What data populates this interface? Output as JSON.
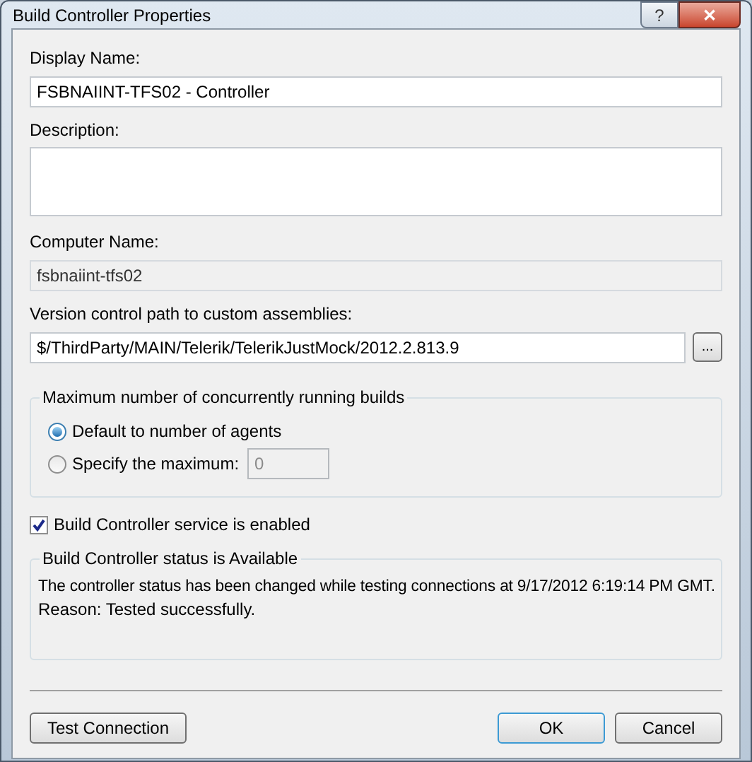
{
  "window": {
    "title": "Build Controller Properties",
    "title_buttons": [
      "?",
      "✕"
    ]
  },
  "display_name": {
    "label": "Display Name:",
    "value": "FSBNAIINT-TFS02 - Controller"
  },
  "description": {
    "label": "Description:"
  },
  "computer_name": {
    "label": "Computer Name:",
    "value": "fsbnaiint-tfs02",
    "disabled": true
  },
  "version_control_path": {
    "label": "Version control path to custom assemblies:",
    "value": "$/ThirdParty/MAIN/Telerik/TelerikJustMock/2012.2.813.9",
    "browse_button": "..."
  },
  "max_builds": {
    "title": "Maximum number of concurrently running builds",
    "options": [
      {
        "label": "Default to number of agents",
        "selected": true
      },
      {
        "label": "Specify the maximum:",
        "selected": false,
        "value": "0"
      }
    ]
  },
  "service_enabled": {
    "label": "Build Controller service is enabled",
    "checked": true
  },
  "status": {
    "title": "Build Controller status is Available",
    "message": "The controller status has been changed while testing connections at 9/17/2012 6:19:14 PM GMT.",
    "reason": "Reason: Tested successfully."
  },
  "buttons": {
    "test": "Test Connection",
    "ok": "OK",
    "cancel": "Cancel"
  }
}
